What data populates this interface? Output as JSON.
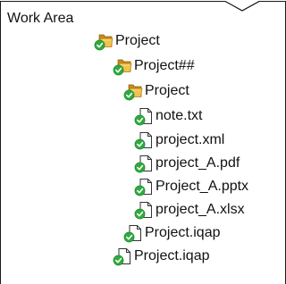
{
  "window": {
    "title": "Work Area"
  },
  "tree": [
    {
      "label": "Project",
      "icon": "folder-check-icon",
      "level": 0
    },
    {
      "label": "Project##",
      "icon": "folder-check-icon",
      "level": 1
    },
    {
      "label": "Project",
      "icon": "folder-check-icon",
      "level": 2
    },
    {
      "label": "note.txt",
      "icon": "file-check-icon",
      "level": 3
    },
    {
      "label": "project.xml",
      "icon": "file-check-icon",
      "level": 3
    },
    {
      "label": "project_A.pdf",
      "icon": "file-check-icon",
      "level": 3
    },
    {
      "label": "Project_A.pptx",
      "icon": "file-check-icon",
      "level": 3
    },
    {
      "label": "project_A.xlsx",
      "icon": "file-check-icon",
      "level": 3
    },
    {
      "label": "Project.iqap",
      "icon": "file-check-icon",
      "level": 2
    },
    {
      "label": "Project.iqap",
      "icon": "file-check-icon",
      "level": 1
    }
  ],
  "colors": {
    "check_green": "#2eaa3e",
    "folder_yellow": "#f2c24b",
    "folder_dark": "#c98b1a",
    "frame": "#1a1a1a"
  }
}
